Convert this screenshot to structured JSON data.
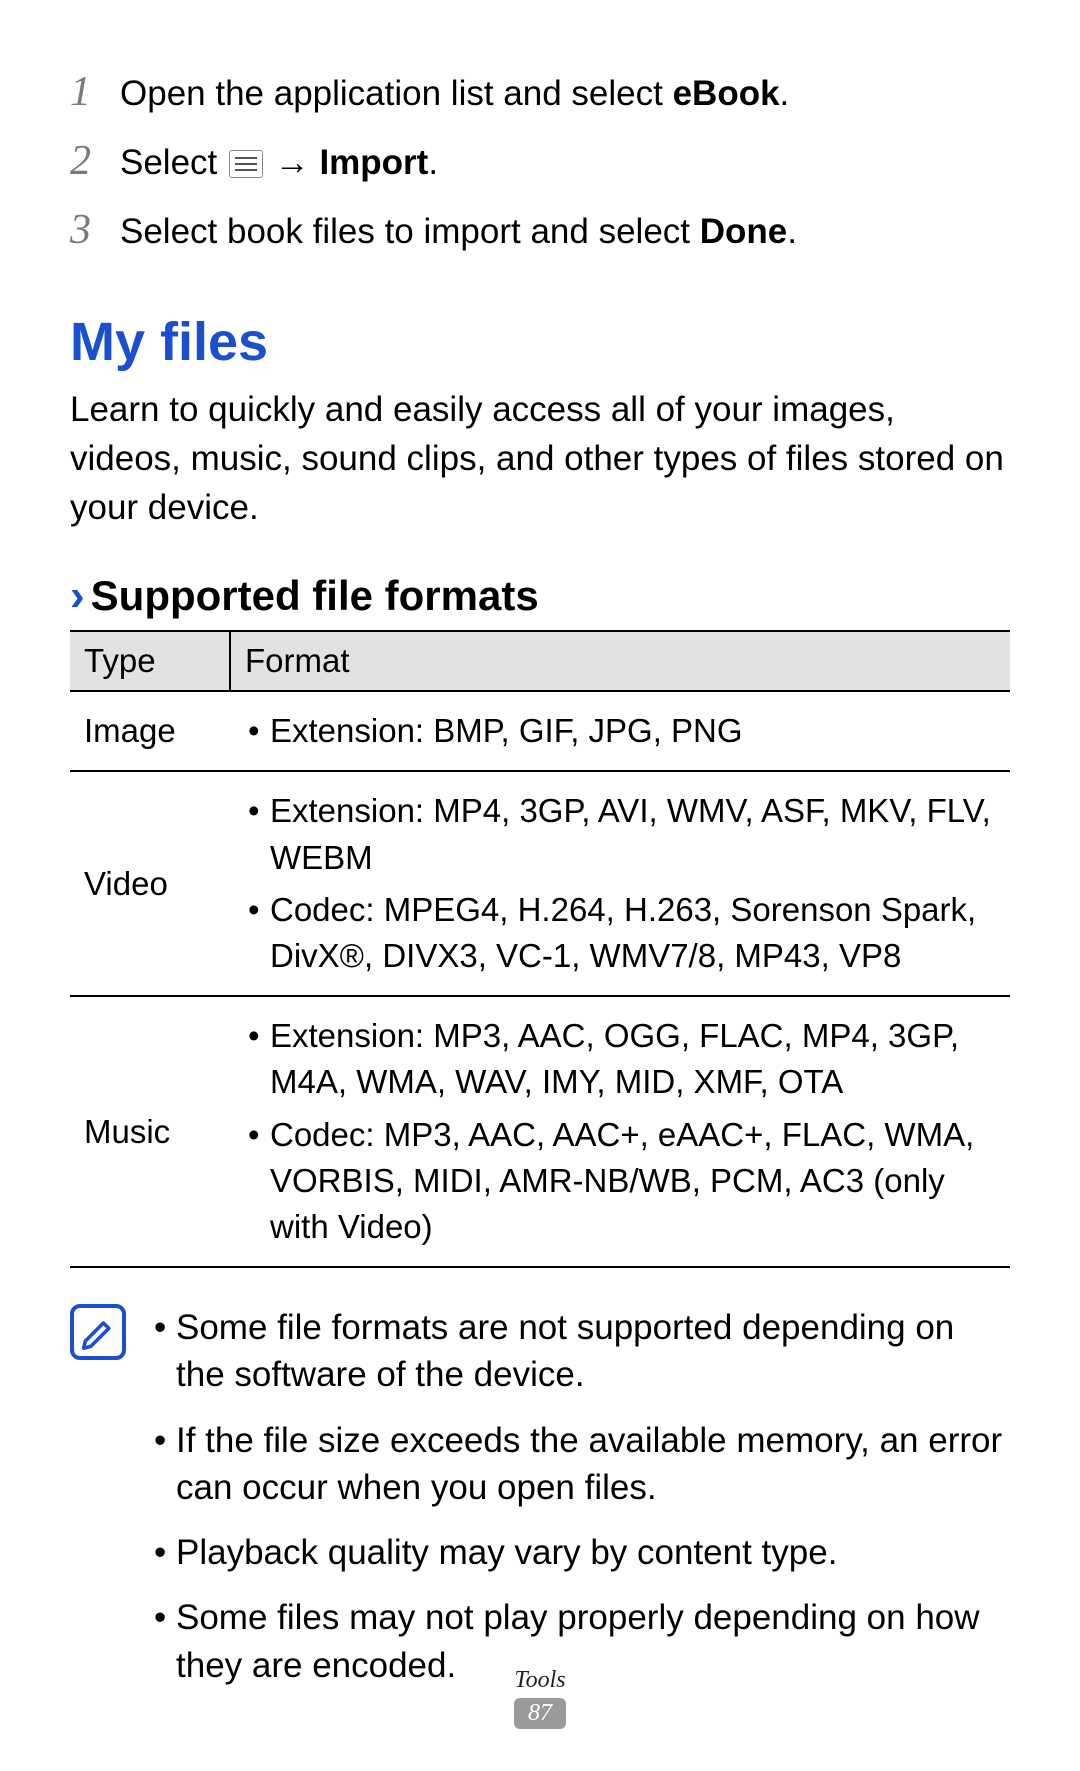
{
  "steps": [
    {
      "prefix": "Open the application list and select ",
      "bold": "eBook",
      "suffix": "."
    },
    {
      "prefix": "Select ",
      "icon": true,
      "arrow": " → ",
      "bold": "Import",
      "suffix": "."
    },
    {
      "prefix": "Select book files to import and select ",
      "bold": "Done",
      "suffix": "."
    }
  ],
  "section": {
    "heading": "My files",
    "intro": "Learn to quickly and easily access all of your images, videos, music, sound clips, and other types of files stored on your device."
  },
  "sub": {
    "chevron": "›",
    "heading": "Supported file formats"
  },
  "table": {
    "headers": {
      "type": "Type",
      "format": "Format"
    },
    "rows": [
      {
        "type": "Image",
        "bullets": [
          "Extension: BMP, GIF, JPG, PNG"
        ]
      },
      {
        "type": "Video",
        "bullets": [
          "Extension: MP4, 3GP, AVI, WMV, ASF, MKV, FLV, WEBM",
          "Codec: MPEG4, H.264, H.263, Sorenson Spark, DivX®, DIVX3, VC-1, WMV7/8, MP43, VP8"
        ]
      },
      {
        "type": "Music",
        "bullets": [
          "Extension: MP3, AAC, OGG, FLAC, MP4, 3GP, M4A, WMA, WAV, IMY, MID, XMF, OTA",
          "Codec: MP3, AAC, AAC+, eAAC+, FLAC, WMA, VORBIS, MIDI, AMR-NB/WB, PCM, AC3 (only with Video)"
        ]
      }
    ]
  },
  "notes": [
    "Some file formats are not supported depending on the software of the device.",
    "If the file size exceeds the available memory, an error can occur when you open files.",
    "Playback quality may vary by content type.",
    "Some files may not play properly depending on how they are encoded."
  ],
  "footer": {
    "section": "Tools",
    "page": "87"
  }
}
